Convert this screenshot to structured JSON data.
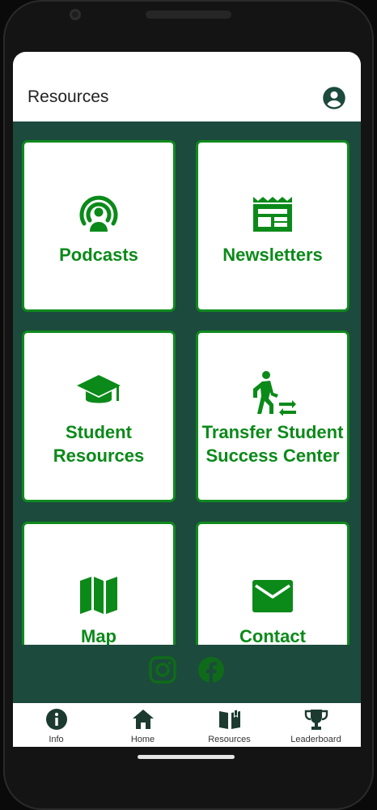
{
  "app_bar": {
    "title": "Resources",
    "account_icon": "account-circle-icon"
  },
  "tiles": [
    {
      "label_lines": [
        "Podcasts"
      ],
      "icon": "podcast-icon"
    },
    {
      "label_lines": [
        "Newsletters"
      ],
      "icon": "newspaper-icon"
    },
    {
      "label_lines": [
        "Student",
        "Resources"
      ],
      "icon": "graduation-cap-icon"
    },
    {
      "label_lines": [
        "Transfer Student",
        "Success Center"
      ],
      "icon": "walking-transfer-icon"
    },
    {
      "label_lines": [
        "Map"
      ],
      "icon": "map-icon"
    },
    {
      "label_lines": [
        "Contact"
      ],
      "icon": "mail-icon"
    }
  ],
  "social": [
    {
      "icon": "instagram-icon"
    },
    {
      "icon": "facebook-icon"
    }
  ],
  "bottom_nav": [
    {
      "label": "Info",
      "icon": "info-icon"
    },
    {
      "label": "Home",
      "icon": "home-icon"
    },
    {
      "label": "Resources",
      "icon": "book-icon"
    },
    {
      "label": "Leaderboard",
      "icon": "trophy-icon"
    }
  ],
  "colors": {
    "accent_green": "#0b8a19",
    "background_dark_green": "#1c4a3d",
    "social_icon_green": "#0f6b1a"
  }
}
